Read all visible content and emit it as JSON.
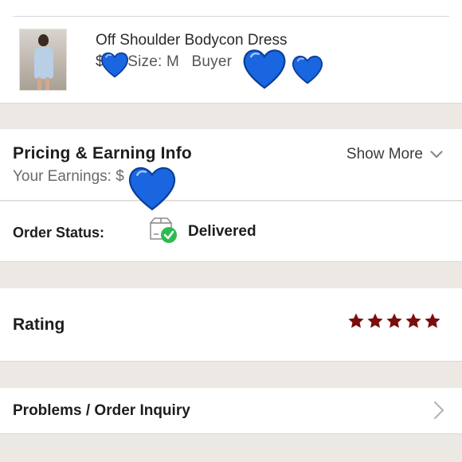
{
  "item": {
    "title": "Off Shoulder Bodycon Dress",
    "price": "$",
    "size": "Size: M",
    "buyer": "Buyer",
    "image_name": "dress-thumbnail"
  },
  "pricing": {
    "title": "Pricing & Earning Info",
    "earnings_label": "Your Earnings: $",
    "show_more_label": "Show More"
  },
  "status": {
    "label": "Order Status:",
    "value": "Delivered"
  },
  "rating": {
    "label": "Rating",
    "stars": 5,
    "star_color": "#7a0d0d"
  },
  "problems": {
    "label": "Problems / Order Inquiry"
  },
  "colors": {
    "background": "#ece9e4",
    "heart": "#1a66e0",
    "check": "#2dbb4f"
  }
}
